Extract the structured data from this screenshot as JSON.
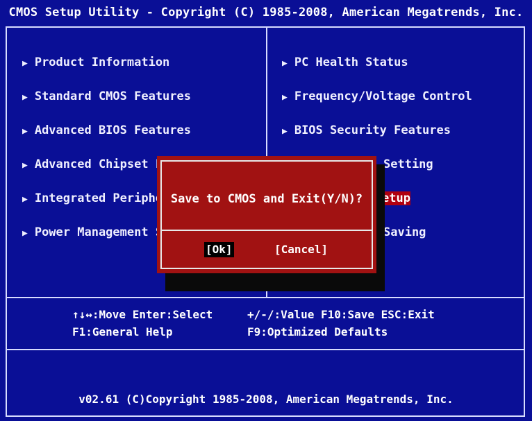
{
  "title": "CMOS Setup Utility - Copyright (C) 1985-2008, American Megatrends, Inc.",
  "left_menu": [
    {
      "label": "Product Information"
    },
    {
      "label": "Standard CMOS Features"
    },
    {
      "label": "Advanced BIOS Features"
    },
    {
      "label": "Advanced Chipset F"
    },
    {
      "label": "Integrated Periphe"
    },
    {
      "label": "Power Management S"
    }
  ],
  "right_menu": [
    {
      "label": "PC Health Status"
    },
    {
      "label": "Frequency/Voltage Control"
    },
    {
      "label": "BIOS Security Features"
    },
    {
      "label": "Setting"
    },
    {
      "label": "etup"
    },
    {
      "label": "Saving"
    }
  ],
  "arrow_glyph": "▶",
  "dialog": {
    "message": "Save to CMOS and Exit(Y/N)?",
    "ok_label": "[Ok]",
    "cancel_label": "[Cancel]"
  },
  "help": {
    "line1_left": "↑↓↔:Move  Enter:Select",
    "line1_right": "+/-/:Value  F10:Save  ESC:Exit",
    "line2_left": "F1:General Help",
    "line2_right": "F9:Optimized Defaults"
  },
  "footer": "v02.61 (C)Copyright 1985-2008, American Megatrends, Inc.",
  "colors": {
    "background": "#0a0f96",
    "dialog": "#a11212",
    "highlight": "#b00010",
    "text": "#ffffff"
  }
}
